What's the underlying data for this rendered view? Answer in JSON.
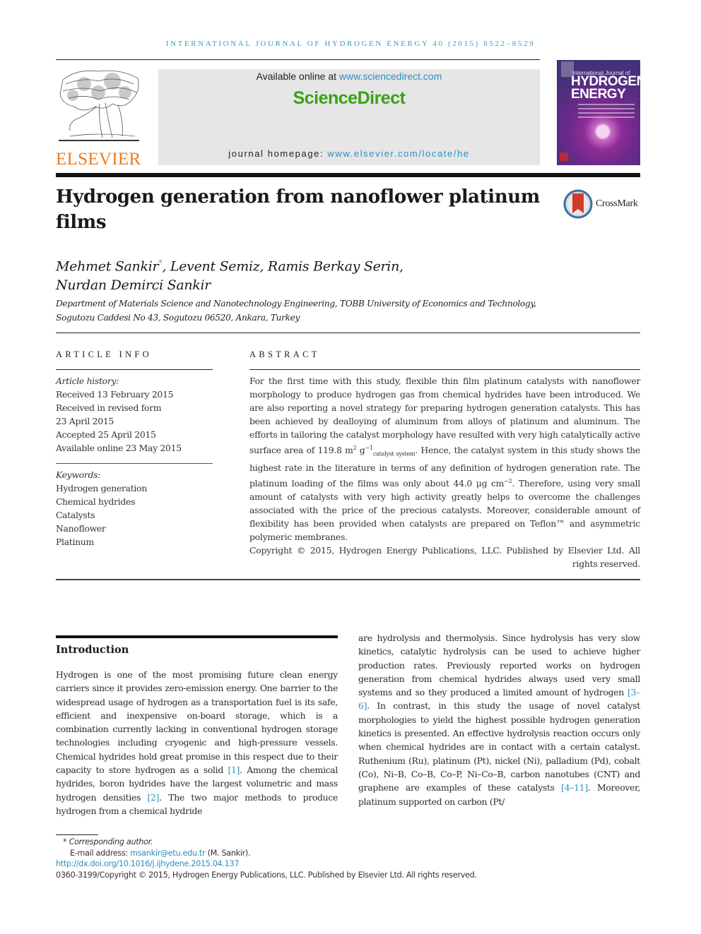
{
  "header": {
    "running_head": "INTERNATIONAL JOURNAL OF HYDROGEN ENERGY 40 (2015) 8522–8529",
    "publisher_logo_text": "ELSEVIER",
    "available_online_prefix": "Available online at ",
    "available_online_link": "www.sciencedirect.com",
    "brand": "ScienceDirect",
    "homepage_prefix": "journal homepage: ",
    "homepage_link": "www.elsevier.com/locate/he",
    "cover": {
      "line1": "International Journal of",
      "line2": "HYDROGEN",
      "line3": "ENERGY"
    }
  },
  "article": {
    "title": "Hydrogen generation from nanoflower platinum films",
    "crossmark_label": "CrossMark",
    "authors": {
      "first": "Mehmet Sankir",
      "first_marker": "*",
      "rest_line1": ", Levent Semiz, Ramis Berkay Serin,",
      "line2": "Nurdan Demirci Sankir"
    },
    "affiliation": {
      "line1": "Department of Materials Science and Nanotechnology Engineering, TOBB University of Economics and Technology,",
      "line2": "Sogutozu Caddesi No 43, Sogutozu 06520, Ankara, Turkey"
    }
  },
  "article_info": {
    "heading": "ARTICLE INFO",
    "history_label": "Article history:",
    "history": [
      "Received 13 February 2015",
      "Received in revised form",
      "23 April 2015",
      "Accepted 25 April 2015",
      "Available online 23 May 2015"
    ],
    "keywords_label": "Keywords:",
    "keywords": [
      "Hydrogen generation",
      "Chemical hydrides",
      "Catalysts",
      "Nanoflower",
      "Platinum"
    ]
  },
  "abstract": {
    "heading": "ABSTRACT",
    "part1": "For the first time with this study, flexible thin film platinum catalysts with nanoflower morphology to produce hydrogen gas from chemical hydrides have been introduced. We are also reporting a novel strategy for preparing hydrogen generation catalysts. This has been achieved by dealloying of aluminum from alloys of platinum and aluminum. The efforts in tailoring the catalyst morphology have resulted with very high catalytically active surface area of 119.8 m",
    "sup1": "2",
    "part2": " g",
    "sup2": "−1",
    "sub1": "catalyst system",
    "part3": ". Hence, the catalyst system in this study shows the highest rate in the literature in terms of any definition of hydrogen generation rate. The platinum loading of the films was only about 44.0 μg cm",
    "sup3": "−2",
    "part4": ". Therefore, using very small amount of catalysts with very high activity greatly helps to overcome the challenges associated with the price of the precious catalysts. Moreover, considerable amount of flexibility has been provided when catalysts are prepared on Teflon™ and asymmetric polymeric membranes.",
    "copyright_line": "Copyright © 2015, Hydrogen Energy Publications, LLC. Published by Elsevier Ltd. All rights reserved."
  },
  "introduction": {
    "heading": "Introduction",
    "left": {
      "t1": "Hydrogen is one of the most promising future clean energy carriers since it provides zero-emission energy. One barrier to the widespread usage of hydrogen as a transportation fuel is its safe, efficient and inexpensive on-board storage, which is a combination currently lacking in conventional hydrogen storage technologies including cryogenic and high-pressure vessels. Chemical hydrides hold great promise in this respect due to their capacity to store hydrogen as a solid ",
      "c1": "[1]",
      "t2": ". Among the chemical hydrides, boron hydrides have the largest volumetric and mass hydrogen densities ",
      "c2": "[2]",
      "t3": ". The two major methods to produce hydrogen from a chemical hydride"
    },
    "right": {
      "t1": "are hydrolysis and thermolysis. Since hydrolysis has very slow kinetics, catalytic hydrolysis can be used to achieve higher production rates. Previously reported works on hydrogen generation from chemical hydrides always used very small systems and so they produced a limited amount of hydrogen ",
      "c1": "[3–6]",
      "t2": ". In contrast, in this study the usage of novel catalyst morphologies to yield the highest possible hydrogen generation kinetics is presented. An effective hydrolysis reaction occurs only when chemical hydrides are in contact with a certain catalyst. Ruthenium (Ru), platinum (Pt), nickel (Ni), palladium (Pd), cobalt (Co), Ni–B, Co–B, Co–P, Ni–Co–B, carbon nanotubes (CNT) and graphene are examples of these catalysts ",
      "c2": "[4–11]",
      "t3": ". Moreover, platinum supported on carbon (Pt/"
    }
  },
  "footnotes": {
    "marker": "*",
    "corresponding": "Corresponding author.",
    "email_label": "E-mail address: ",
    "email": "msankir@etu.edu.tr",
    "email_suffix": " (M. Sankir).",
    "doi": "http://dx.doi.org/10.1016/j.ijhydene.2015.04.137",
    "issn_copyright": "0360-3199/Copyright © 2015, Hydrogen Energy Publications, LLC. Published by Elsevier Ltd. All rights reserved."
  },
  "colors": {
    "link": "#2b8fc0",
    "brand_green": "#38a215",
    "elsevier_orange": "#f07a1a",
    "running_head": "#3a9cc4"
  }
}
